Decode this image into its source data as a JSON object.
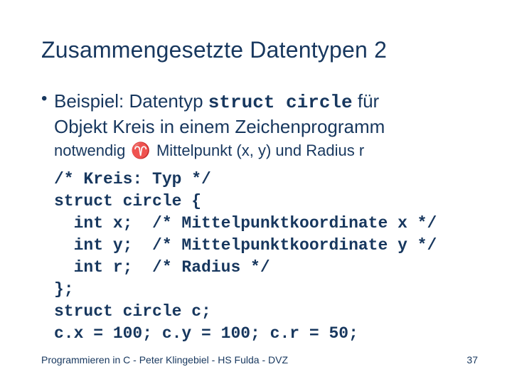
{
  "title": "Zusammengesetzte Datentypen 2",
  "bullet": {
    "line1_pre": "Beispiel: Datentyp ",
    "line1_code": "struct circle",
    "line1_post": " für",
    "line2": "Objekt Kreis in einem Zeichenprogramm",
    "sub_pre": "notwendig ",
    "sub_icon": "♈",
    "sub_post": " Mittelpunkt (x, y) und Radius r"
  },
  "code": {
    "l1": "/* Kreis: Typ */",
    "l2": "struct circle {",
    "l3": "  int x;  /* Mittelpunktkoordinate x */",
    "l4": "  int y;  /* Mittelpunktkoordinate y */",
    "l5": "  int r;  /* Radius */",
    "l6": "};",
    "l7": "struct circle c;",
    "l8": "c.x = 100; c.y = 100; c.r = 50;"
  },
  "footer": "Programmieren in C - Peter Klingebiel - HS Fulda - DVZ",
  "page": "37"
}
